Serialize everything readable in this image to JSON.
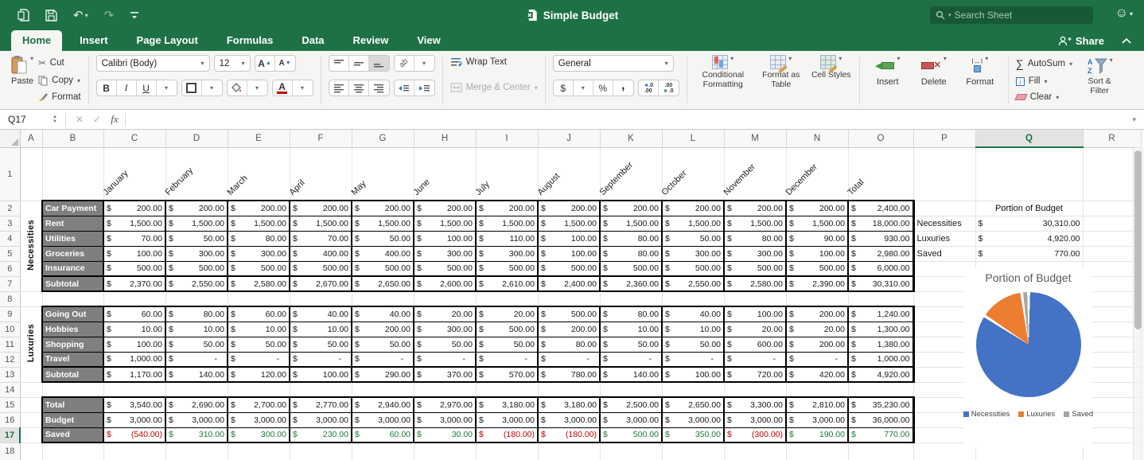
{
  "titlebar": {
    "title": "Simple Budget",
    "search_placeholder": "Search Sheet",
    "share_label": "Share"
  },
  "tabs": {
    "items": [
      "Home",
      "Insert",
      "Page Layout",
      "Formulas",
      "Data",
      "Review",
      "View"
    ],
    "active": "Home"
  },
  "ribbon": {
    "clipboard": {
      "paste": "Paste",
      "cut": "Cut",
      "copy": "Copy",
      "format": "Format"
    },
    "font": {
      "family": "Calibri (Body)",
      "size": "12"
    },
    "alignment": {
      "wrap_text": "Wrap Text",
      "merge_center": "Merge & Center"
    },
    "number": {
      "format": "General"
    },
    "styles": {
      "conditional": "Conditional Formatting",
      "table": "Format as Table",
      "cell": "Cell Styles"
    },
    "cells": {
      "insert": "Insert",
      "delete": "Delete",
      "format": "Format"
    },
    "editing": {
      "autosum": "AutoSum",
      "fill": "Fill",
      "clear": "Clear",
      "sort": "Sort & Filter"
    }
  },
  "formula_bar": {
    "cell_ref": "Q17"
  },
  "grid": {
    "columns": [
      "A",
      "B",
      "C",
      "D",
      "E",
      "F",
      "G",
      "H",
      "I",
      "J",
      "K",
      "L",
      "M",
      "N",
      "O",
      "P",
      "Q",
      "R"
    ],
    "row_count": 18,
    "selected_column": "Q",
    "selected_row": 17
  },
  "sheet": {
    "months": [
      "January",
      "February",
      "March",
      "April",
      "May",
      "June",
      "July",
      "August",
      "September",
      "October",
      "November",
      "December",
      "Total"
    ],
    "sections": [
      {
        "group": "Necessities",
        "rows": [
          {
            "label": "Car Payment",
            "values": [
              "200.00",
              "200.00",
              "200.00",
              "200.00",
              "200.00",
              "200.00",
              "200.00",
              "200.00",
              "200.00",
              "200.00",
              "200.00",
              "200.00",
              "2,400.00"
            ]
          },
          {
            "label": "Rent",
            "values": [
              "1,500.00",
              "1,500.00",
              "1,500.00",
              "1,500.00",
              "1,500.00",
              "1,500.00",
              "1,500.00",
              "1,500.00",
              "1,500.00",
              "1,500.00",
              "1,500.00",
              "1,500.00",
              "18,000.00"
            ]
          },
          {
            "label": "Utilities",
            "values": [
              "70.00",
              "50.00",
              "80.00",
              "70.00",
              "50.00",
              "100.00",
              "110.00",
              "100.00",
              "80.00",
              "50.00",
              "80.00",
              "90.00",
              "930.00"
            ]
          },
          {
            "label": "Groceries",
            "values": [
              "100.00",
              "300.00",
              "300.00",
              "400.00",
              "400.00",
              "300.00",
              "300.00",
              "100.00",
              "80.00",
              "300.00",
              "300.00",
              "100.00",
              "2,980.00"
            ]
          },
          {
            "label": "Insurance",
            "values": [
              "500.00",
              "500.00",
              "500.00",
              "500.00",
              "500.00",
              "500.00",
              "500.00",
              "500.00",
              "500.00",
              "500.00",
              "500.00",
              "500.00",
              "6,000.00"
            ]
          },
          {
            "label": "Subtotal",
            "values": [
              "2,370.00",
              "2,550.00",
              "2,580.00",
              "2,670.00",
              "2,650.00",
              "2,600.00",
              "2,610.00",
              "2,400.00",
              "2,360.00",
              "2,550.00",
              "2,580.00",
              "2,390.00",
              "30,310.00"
            ]
          }
        ]
      },
      {
        "group": "Luxuries",
        "rows": [
          {
            "label": "Going Out",
            "values": [
              "60.00",
              "80.00",
              "60.00",
              "40.00",
              "40.00",
              "20.00",
              "20.00",
              "500.00",
              "80.00",
              "40.00",
              "100.00",
              "200.00",
              "1,240.00"
            ]
          },
          {
            "label": "Hobbies",
            "values": [
              "10.00",
              "10.00",
              "10.00",
              "10.00",
              "200.00",
              "300.00",
              "500.00",
              "200.00",
              "10.00",
              "10.00",
              "20.00",
              "20.00",
              "1,300.00"
            ]
          },
          {
            "label": "Shopping",
            "values": [
              "100.00",
              "50.00",
              "50.00",
              "50.00",
              "50.00",
              "50.00",
              "50.00",
              "80.00",
              "50.00",
              "50.00",
              "600.00",
              "200.00",
              "1,380.00"
            ]
          },
          {
            "label": "Travel",
            "values": [
              "1,000.00",
              "-",
              "-",
              "-",
              "-",
              "-",
              "-",
              "-",
              "-",
              "-",
              "-",
              "-",
              "1,000.00"
            ]
          },
          {
            "label": "Subtotal",
            "values": [
              "1,170.00",
              "140.00",
              "120.00",
              "100.00",
              "290.00",
              "370.00",
              "570.00",
              "780.00",
              "140.00",
              "100.00",
              "720.00",
              "420.00",
              "4,920.00"
            ]
          }
        ]
      },
      {
        "group": null,
        "rows": [
          {
            "label": "Total",
            "values": [
              "3,540.00",
              "2,690.00",
              "2,700.00",
              "2,770.00",
              "2,940.00",
              "2,970.00",
              "3,180.00",
              "3,180.00",
              "2,500.00",
              "2,650.00",
              "3,300.00",
              "2,810.00",
              "35,230.00"
            ]
          },
          {
            "label": "Budget",
            "values": [
              "3,000.00",
              "3,000.00",
              "3,000.00",
              "3,000.00",
              "3,000.00",
              "3,000.00",
              "3,000.00",
              "3,000.00",
              "3,000.00",
              "3,000.00",
              "3,000.00",
              "3,000.00",
              "36,000.00"
            ]
          },
          {
            "label": "Saved",
            "values": [
              "(540.00)",
              "310.00",
              "300.00",
              "230.00",
              "60.00",
              "30.00",
              "(180.00)",
              "(180.00)",
              "500.00",
              "350.00",
              "(300.00)",
              "190.00",
              "770.00"
            ]
          }
        ]
      }
    ]
  },
  "summary": {
    "header": "Portion of Budget",
    "rows": [
      {
        "label": "Necessities",
        "value": "30,310.00"
      },
      {
        "label": "Luxuries",
        "value": "4,920.00"
      },
      {
        "label": "Saved",
        "value": "770.00"
      }
    ]
  },
  "chart_data": {
    "type": "pie",
    "title": "Portion of Budget",
    "categories": [
      "Necessities",
      "Luxuries",
      "Saved"
    ],
    "values": [
      30310,
      4920,
      770
    ],
    "colors": [
      "#4472c4",
      "#ed7d31",
      "#a5a5a5"
    ],
    "legend_position": "bottom"
  }
}
